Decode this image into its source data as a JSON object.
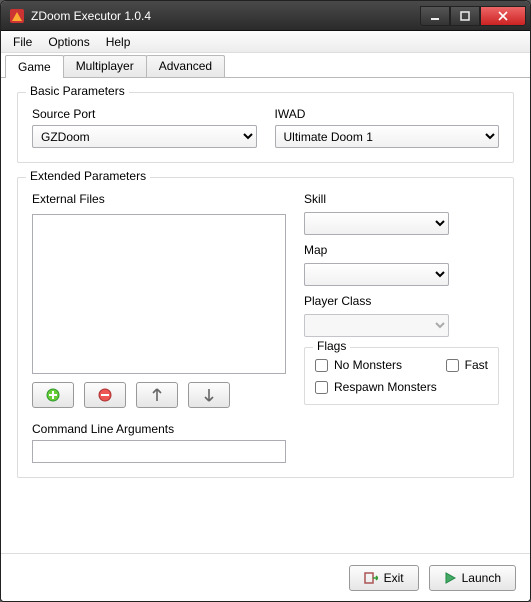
{
  "window": {
    "title": "ZDoom Executor 1.0.4"
  },
  "menubar": {
    "items": [
      "File",
      "Options",
      "Help"
    ]
  },
  "tabs": {
    "items": [
      "Game",
      "Multiplayer",
      "Advanced"
    ],
    "active": 0
  },
  "basic": {
    "title": "Basic Parameters",
    "sourcePort": {
      "label": "Source Port",
      "value": "GZDoom"
    },
    "iwad": {
      "label": "IWAD",
      "value": "Ultimate Doom 1"
    }
  },
  "extended": {
    "title": "Extended Parameters",
    "externalFiles": {
      "label": "External Files"
    },
    "skill": {
      "label": "Skill",
      "value": ""
    },
    "map": {
      "label": "Map",
      "value": ""
    },
    "playerClass": {
      "label": "Player Class",
      "value": "",
      "disabled": true
    },
    "flags": {
      "title": "Flags",
      "noMonsters": {
        "label": "No Monsters",
        "checked": false
      },
      "fast": {
        "label": "Fast",
        "checked": false
      },
      "respawn": {
        "label": "Respawn Monsters",
        "checked": false
      }
    },
    "cla": {
      "label": "Command Line Arguments",
      "value": ""
    }
  },
  "footer": {
    "exit": "Exit",
    "launch": "Launch"
  }
}
